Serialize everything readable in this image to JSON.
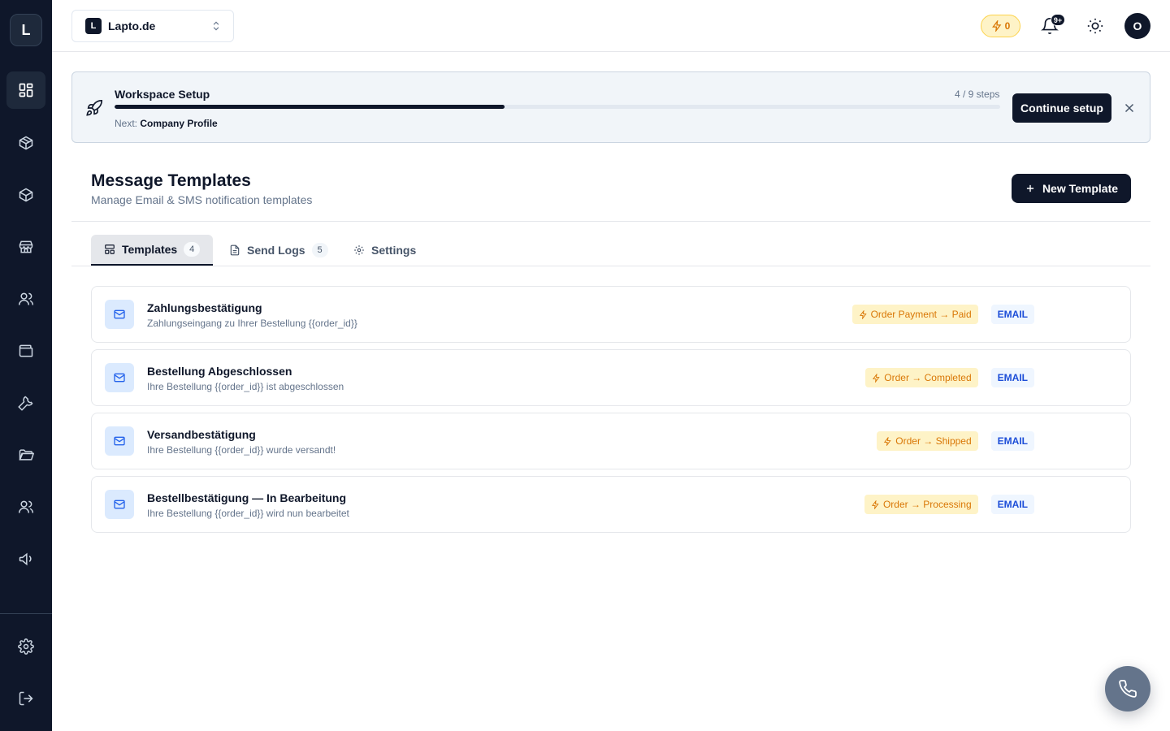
{
  "app": {
    "logo_letter": "L",
    "workspace": {
      "badge": "L",
      "name": "Lapto.de"
    }
  },
  "header": {
    "credits": "0",
    "notifications_badge": "9+",
    "avatar_initial": "O"
  },
  "sidebar": {
    "items": [
      {
        "icon": "dashboard-icon",
        "active": true
      },
      {
        "icon": "package-icon"
      },
      {
        "icon": "box-icon"
      },
      {
        "icon": "store-icon"
      },
      {
        "icon": "users-icon"
      },
      {
        "icon": "wallet-icon"
      },
      {
        "icon": "wrench-icon"
      },
      {
        "icon": "folder-icon"
      },
      {
        "icon": "team-icon"
      },
      {
        "icon": "megaphone-icon"
      },
      {
        "icon": "settings-icon"
      },
      {
        "icon": "logout-icon"
      }
    ]
  },
  "setup": {
    "title": "Workspace Setup",
    "steps_text": "4 / 9 steps",
    "progress": 0.44,
    "next_label": "Next:",
    "next_value": "Company Profile",
    "button": "Continue setup"
  },
  "page": {
    "title": "Message Templates",
    "subtitle": "Manage Email & SMS notification templates",
    "new_button": "New Template"
  },
  "tabs": [
    {
      "label": "Templates",
      "count": "4",
      "active": true
    },
    {
      "label": "Send Logs",
      "count": "5"
    },
    {
      "label": "Settings"
    }
  ],
  "templates": [
    {
      "name": "Zahlungsbestätigung",
      "description": "Zahlungseingang zu Ihrer Bestellung {{order_id}}",
      "trigger": "Order Payment → Paid",
      "channel": "EMAIL"
    },
    {
      "name": "Bestellung Abgeschlossen",
      "description": "Ihre Bestellung {{order_id}} ist abgeschlossen",
      "trigger": "Order → Completed",
      "channel": "EMAIL"
    },
    {
      "name": "Versandbestätigung",
      "description": "Ihre Bestellung {{order_id}} wurde versandt!",
      "trigger": "Order → Shipped",
      "channel": "EMAIL"
    },
    {
      "name": "Bestellbestätigung — In Bearbeitung",
      "description": "Ihre Bestellung {{order_id}} wird nun bearbeitet",
      "trigger": "Order → Processing",
      "channel": "EMAIL"
    }
  ],
  "colors": {
    "sidebar_bg": "#0f172a",
    "primary": "#0f172a",
    "trigger_bg": "#fef3c7",
    "trigger_text": "#d97706",
    "channel_text": "#1d4ed8"
  }
}
